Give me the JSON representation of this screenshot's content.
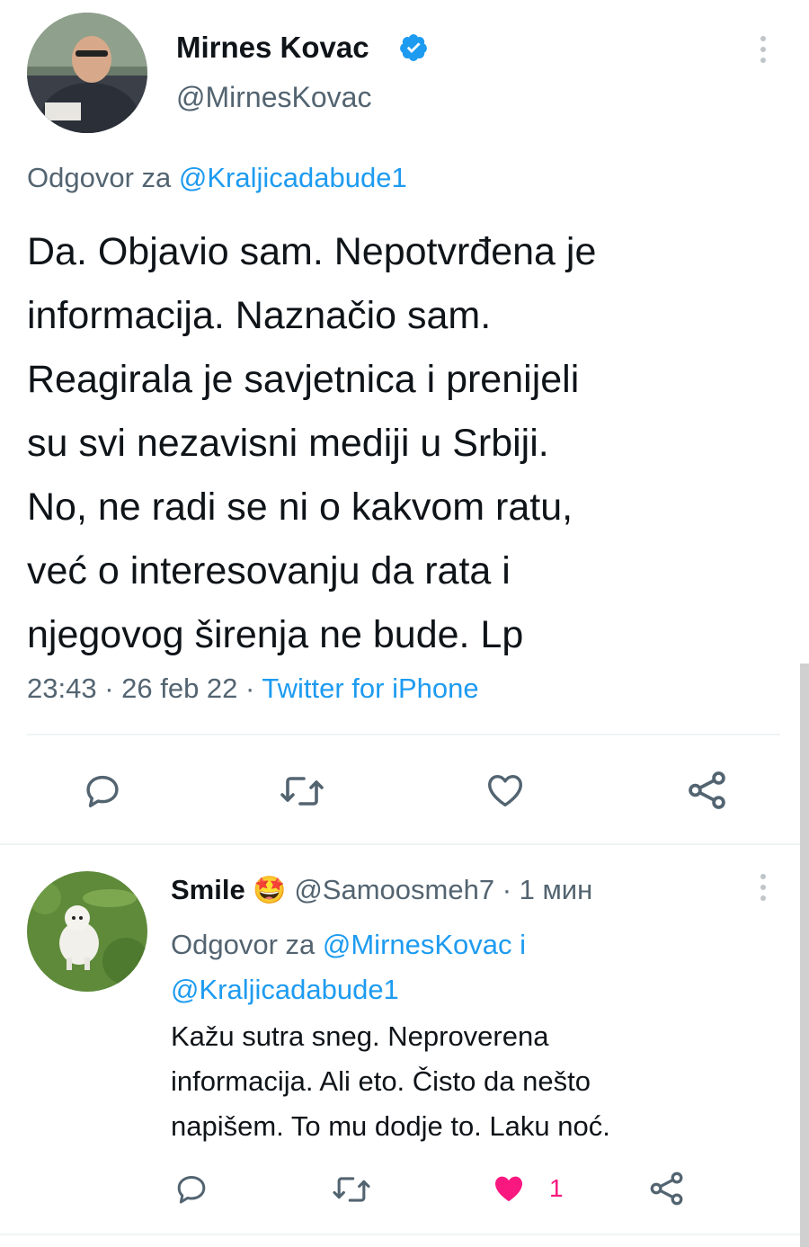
{
  "main_tweet": {
    "author": {
      "display_name": "Mirnes Kovac",
      "handle": "@MirnesKovac",
      "verified_icon": "verified-badge-icon"
    },
    "reply_prefix": "Odgovor za",
    "reply_to": "@Kraljicadabude1",
    "text_lines": [
      "Da. Objavio sam. Nepotvrđena je",
      "informacija. Naznačio sam.",
      "Reagirala je savjetnica i prenijeli",
      "su svi nezavisni mediji u Srbiji.",
      "No, ne radi se ni o kakvom ratu,",
      "već o interesovanju da rata i",
      "njegovog širenja ne bude. Lp"
    ],
    "timestamp": "23:43 · 26 feb 22 · ",
    "source": "Twitter for iPhone",
    "actions": {
      "reply_icon": "reply-icon",
      "retweet_icon": "retweet-icon",
      "like_icon": "heart-outline-icon",
      "share_icon": "share-icon"
    }
  },
  "reply_tweet": {
    "author": {
      "display_name": "Smile",
      "emoji": "🤩",
      "handle": "@Samoosmeh7",
      "time": " · 1 мин"
    },
    "reply_prefix": "Odgovor za",
    "reply_to_1": "@MirnesKovac",
    "reply_and": " i",
    "reply_to_2": "@Kraljicadabude1",
    "text_lines": [
      "Kažu sutra sneg. Neproverena",
      "informacija. Ali eto. Čisto da nešto",
      "napišem. To mu dodje to. Laku noć."
    ],
    "like_count": "1",
    "colors": {
      "liked": "#f91880"
    }
  },
  "colors": {
    "link": "#1d9bf0",
    "muted": "#536471",
    "text": "#0f1419"
  }
}
